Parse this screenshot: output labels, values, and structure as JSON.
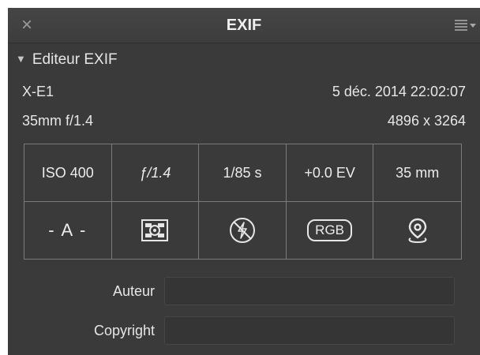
{
  "panel": {
    "title": "EXIF",
    "close_icon": "close-icon",
    "menu_icon": "menu-icon"
  },
  "section": {
    "label": "Editeur EXIF",
    "expanded": true
  },
  "info": {
    "camera": "X-E1",
    "datetime": "5 déc. 2014 22:02:07",
    "lens": "35mm f/1.4",
    "dimensions": "4896 x 3264"
  },
  "exif_values": {
    "iso": "ISO 400",
    "aperture": "ƒ/1.4",
    "shutter": "1/85 s",
    "exposure_comp": "+0.0 EV",
    "focal_length": "35 mm"
  },
  "exif_modes": {
    "exposure_mode": "- A -",
    "metering_icon": "metering-icon",
    "flash_icon": "flash-off-icon",
    "color_space": "RGB",
    "location_icon": "location-pin-icon"
  },
  "form": {
    "author_label": "Auteur",
    "author_value": "",
    "copyright_label": "Copyright",
    "copyright_value": ""
  },
  "colors": {
    "panel_bg": "#3a3a3a",
    "text": "#e6e6e6",
    "grid_border": "#7a7a7a"
  }
}
